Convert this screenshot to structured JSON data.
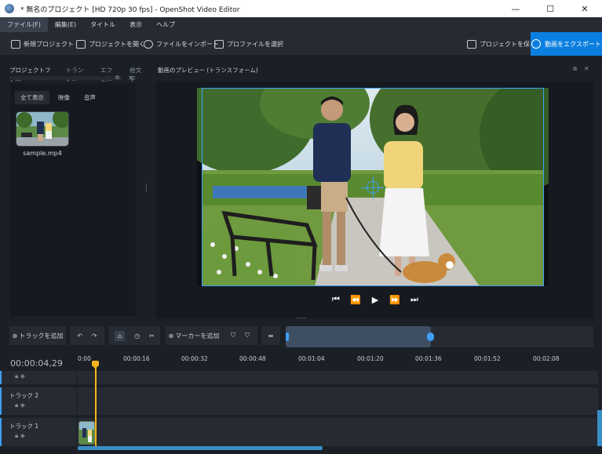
{
  "window": {
    "title": "* 無名のプロジェクト [HD 720p 30 fps] - OpenShot Video Editor",
    "min": "—",
    "max": "☐",
    "close": "✕"
  },
  "menu": [
    "ファイル(F)",
    "編集(E)",
    "タイトル",
    "表示",
    "ヘルプ"
  ],
  "toolbar": {
    "new_project": "新規プロジェクト",
    "open_project": "プロジェクトを開く",
    "import_files": "ファイルをインポート",
    "choose_profile": "プロファイルを選択",
    "save_project": "プロジェクトを保存",
    "export_video": "動画をエクスポート"
  },
  "left_panel": {
    "tabs": [
      "プロジェクトファ...",
      "トランジ...",
      "エフェ...",
      "絵文字"
    ],
    "filters": [
      "全て表示",
      "映像",
      "音声"
    ],
    "file_name": "sample.mp4"
  },
  "preview": {
    "title": "動画のプレビュー (トランスフォーム)"
  },
  "timeline_toolbar": {
    "add_track": "トラックを追加",
    "add_marker": "マーカーを追加"
  },
  "timeline": {
    "current_time": "00:00:04,29",
    "ruler_ticks": [
      "0:00",
      "00:00:16",
      "00:00:32",
      "00:00:48",
      "00:01:04",
      "00:01:20",
      "00:01:36",
      "00:01:52",
      "00:02:08"
    ],
    "tracks": [
      "トラック 2",
      "トラック 1"
    ]
  }
}
